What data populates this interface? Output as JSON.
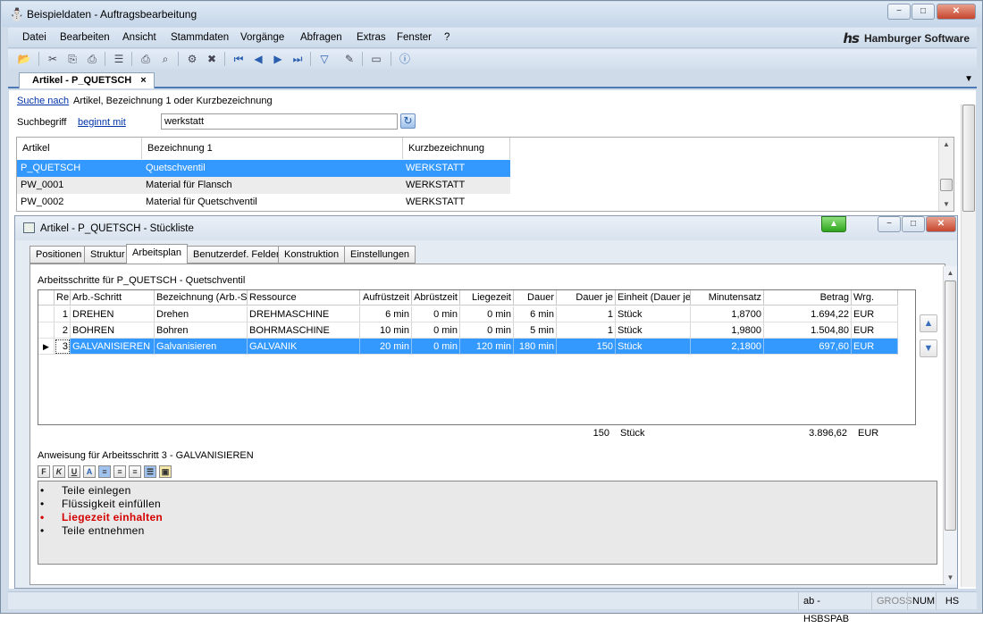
{
  "window": {
    "title": "Beispieldaten - Auftragsbearbeitung",
    "app_icon": "app-logo-icon"
  },
  "menu": {
    "items": [
      "Datei",
      "Bearbeiten",
      "Ansicht",
      "Stammdaten",
      "Vorgänge",
      "Abfragen",
      "Extras",
      "Fenster",
      "?"
    ]
  },
  "logo": {
    "text": "Hamburger Software",
    "mark": "hs"
  },
  "toolbar": {
    "icons": [
      "open-folder-icon",
      "cut-icon",
      "copy-icon",
      "paste-icon",
      "list-icon",
      "print-icon",
      "print-preview-icon",
      "settings-icon",
      "delete-icon",
      "first-record-icon",
      "prev-record-icon",
      "next-record-icon",
      "last-record-icon",
      "filter-icon",
      "edit-document-icon",
      "window-icon",
      "help-icon"
    ]
  },
  "doc_tab": {
    "label": "Artikel - P_QUETSCH",
    "close": "×"
  },
  "search": {
    "search_link": "Suche nach",
    "search_desc": "Artikel, Bezeichnung 1 oder Kurzbezeichnung",
    "term_label": "Suchbegriff",
    "mode_link": "beginnt mit",
    "value": "werkstatt"
  },
  "top_grid": {
    "headers": [
      "Artikel",
      "Bezeichnung 1",
      "Kurzbezeichnung"
    ],
    "rows": [
      {
        "artikel": "P_QUETSCH",
        "bez": "Quetschventil",
        "kurz": "WERKSTATT"
      },
      {
        "artikel": "PW_0001",
        "bez": "Material für Flansch",
        "kurz": "WERKSTATT"
      },
      {
        "artikel": "PW_0002",
        "bez": "Material für Quetschventil",
        "kurz": "WERKSTATT"
      }
    ],
    "selected_index": 0
  },
  "child": {
    "title": "Artikel - P_QUETSCH - Stückliste"
  },
  "inner_tabs": [
    "Positionen",
    "Struktur",
    "Arbeitsplan",
    "Benutzerdef. Felder",
    "Konstruktion",
    "Einstellungen"
  ],
  "active_inner_tab": "Arbeitsplan",
  "ap": {
    "caption": "Arbeitsschritte für P_QUETSCH - Quetschventil",
    "headers": [
      "Re",
      "Arb.-Schritt",
      "Bezeichnung (Arb.-Sc",
      "Ressource",
      "Aufrüstzeit",
      "Abrüstzeit",
      "Liegezeit",
      "Dauer",
      "Dauer je",
      "Einheit (Dauer je)",
      "Minutensatz",
      "Betrag",
      "Wrg."
    ],
    "rows": [
      {
        "nr": "1",
        "schritt": "DREHEN",
        "bez": "Drehen",
        "res": "DREHMASCHINE",
        "auf": "6 min",
        "ab": "0 min",
        "lieg": "0 min",
        "dauer": "6 min",
        "je": "1",
        "einheit": "Stück",
        "satz": "1,8700",
        "betrag": "1.694,22",
        "wrg": "EUR"
      },
      {
        "nr": "2",
        "schritt": "BOHREN",
        "bez": "Bohren",
        "res": "BOHRMASCHINE",
        "auf": "10 min",
        "ab": "0 min",
        "lieg": "0 min",
        "dauer": "5 min",
        "je": "1",
        "einheit": "Stück",
        "satz": "1,9800",
        "betrag": "1.504,80",
        "wrg": "EUR"
      },
      {
        "nr": "3",
        "schritt": "GALVANISIEREN",
        "bez": "Galvanisieren",
        "res": "GALVANIK",
        "auf": "20 min",
        "ab": "0 min",
        "lieg": "120 min",
        "dauer": "180 min",
        "je": "150",
        "einheit": "Stück",
        "satz": "2,1800",
        "betrag": "697,60",
        "wrg": "EUR"
      }
    ],
    "selected_index": 2,
    "totals": {
      "je": "150",
      "einheit": "Stück",
      "betrag": "3.896,62",
      "wrg": "EUR"
    }
  },
  "instructions": {
    "caption": "Anweisung für Arbeitsschritt 3 - GALVANISIEREN",
    "format_buttons": [
      "F",
      "K",
      "U",
      "A",
      "align-left-icon",
      "align-center-icon",
      "align-justify-icon",
      "list-icon",
      "image-icon"
    ],
    "lines": [
      {
        "text": "Teile einlegen",
        "highlight": false
      },
      {
        "text": "Flüssigkeit einfüllen",
        "highlight": false
      },
      {
        "text": "Liegezeit einhalten",
        "highlight": true
      },
      {
        "text": "Teile entnehmen",
        "highlight": false
      }
    ],
    "highlight_color": "#d40000"
  },
  "status": {
    "user": "ab - HSBSPAB",
    "caps": "GROSS",
    "num": "NUM",
    "mode": "HS"
  },
  "colors": {
    "selection": "#3399ff",
    "accent": "#4d79b5"
  }
}
